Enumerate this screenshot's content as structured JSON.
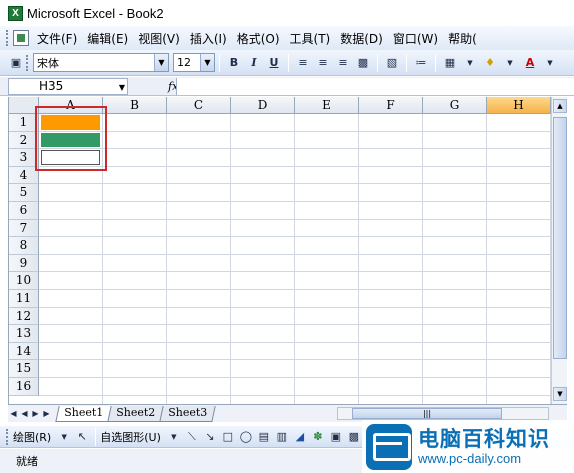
{
  "window": {
    "title": "Microsoft Excel - Book2"
  },
  "menu": [
    "文件(F)",
    "编辑(E)",
    "视图(V)",
    "插入(I)",
    "格式(O)",
    "工具(T)",
    "数据(D)",
    "窗口(W)",
    "帮助("
  ],
  "toolbar": {
    "font": "宋体",
    "size": "12",
    "bold": "B",
    "italic": "I",
    "underline": "U"
  },
  "formula": {
    "cell_ref": "H35",
    "fx": "fx",
    "value": ""
  },
  "columns": [
    "A",
    "B",
    "C",
    "D",
    "E",
    "F",
    "G",
    "H"
  ],
  "active_column": "H",
  "rows": [
    "1",
    "2",
    "3",
    "4",
    "5",
    "6",
    "7",
    "8",
    "9",
    "10",
    "11",
    "12",
    "13",
    "14",
    "15",
    "16"
  ],
  "cells": [
    {
      "ref": "A1",
      "fill": "#ff9900"
    },
    {
      "ref": "A2",
      "fill": "#339966"
    },
    {
      "ref": "A3",
      "fill": "#ffffff"
    }
  ],
  "sheets": {
    "tabs": [
      "Sheet1",
      "Sheet2",
      "Sheet3"
    ],
    "active": "Sheet1"
  },
  "drawing": {
    "draw_label": "绘图(R)",
    "autoshape_label": "自选图形(U)"
  },
  "status": {
    "text": "就绪"
  },
  "watermark": {
    "title": "电脑百科知识",
    "url": "www.pc-daily.com"
  },
  "colors": {
    "highlight_border": "#cc2a2a",
    "active_header": "#f4b24a"
  }
}
